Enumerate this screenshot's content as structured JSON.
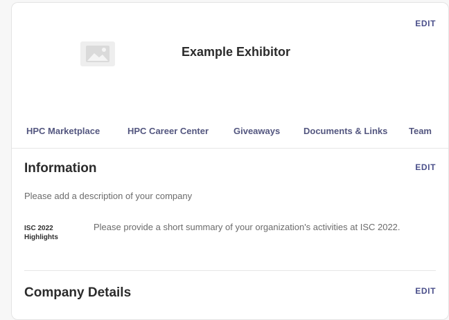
{
  "header": {
    "edit_label": "EDIT",
    "title": "Example Exhibitor",
    "logo_icon": "image-placeholder-icon"
  },
  "tabs": [
    {
      "label": "HPC Marketplace"
    },
    {
      "label": "HPC Career Center"
    },
    {
      "label": "Giveaways"
    },
    {
      "label": "Documents & Links"
    },
    {
      "label": "Team"
    }
  ],
  "information": {
    "title": "Information",
    "edit_label": "EDIT",
    "description": "Please add a description of your company",
    "highlight_label_line1": "ISC 2022",
    "highlight_label_line2": "Highlights",
    "highlight_text": "Please provide a short summary of your organization's activities at ISC 2022."
  },
  "company_details": {
    "title": "Company Details",
    "edit_label": "EDIT"
  },
  "colors": {
    "accent": "#4a4f8a",
    "tab_text": "#53567f",
    "muted_text": "#6b6b6b"
  }
}
